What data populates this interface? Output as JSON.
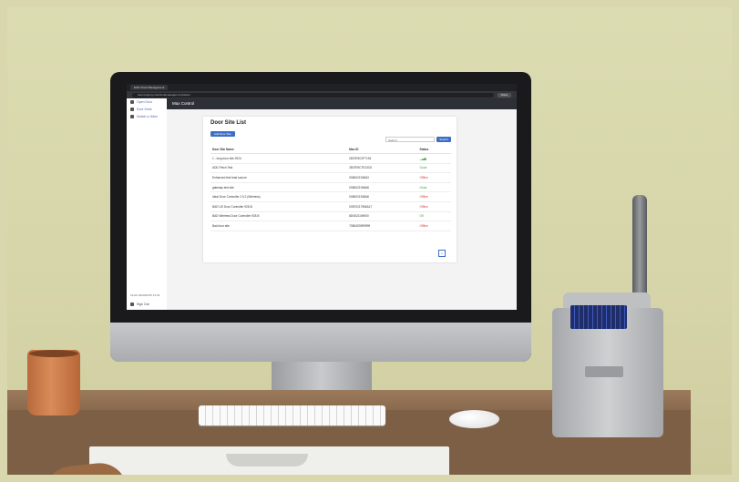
{
  "browser": {
    "tab_label": "EUD Cloud Management",
    "url": "door.longrng.cnet/cloudmanager.com/doors",
    "button_label": "Done"
  },
  "sidebar": {
    "items": [
      {
        "label": "Open Door",
        "icon": "door-icon"
      },
      {
        "label": "Door Desk",
        "icon": "list-icon"
      },
      {
        "label": "Switch a Video",
        "icon": "gear-icon"
      }
    ],
    "footer": "Finish 2024/01/05 13:43",
    "signout": "Sign Out"
  },
  "header": {
    "title": "Max Control"
  },
  "card": {
    "title": "Door Site List",
    "add_button": "Add Door Site",
    "search_placeholder": "Search",
    "search_button": "Search",
    "columns": [
      "Door Site Name",
      "Mac ID",
      "Status"
    ],
    "rows": [
      {
        "name": "1 - long door site 2024",
        "mac": "2807E9C0F7194",
        "status": "signal-icon",
        "status_text": ""
      },
      {
        "name": "ADD Fetch Test",
        "mac": "2807E9C7E13C6",
        "status": "",
        "status_text": "Good"
      },
      {
        "name": "Enhanced test lead source",
        "mac": "0080021948A3",
        "status": "",
        "status_text": "Offline"
      },
      {
        "name": "gateway test site",
        "mac": "0080021948A8",
        "status": "",
        "status_text": "Good"
      },
      {
        "name": "Ideal Door Controller 2.5.2 (Wireless)",
        "mac": "0080021948A8",
        "status": "",
        "status_text": "Offline"
      },
      {
        "name": "BAD US Door Controller 925-B",
        "mac": "00870217966A17",
        "status": "",
        "status_text": "Offline"
      },
      {
        "name": "BAD Wireless Door Controller 925-B",
        "mac": "8D0621194900",
        "status": "",
        "status_text": "OK"
      },
      {
        "name": "Bad door site",
        "mac": "7080403999999",
        "status": "",
        "status_text": "Offline"
      }
    ],
    "page": "1"
  },
  "colors": {
    "accent": "#3d6fc6",
    "header": "#2d3037",
    "ok": "#3a9a3a",
    "offline": "#d23b3b"
  }
}
